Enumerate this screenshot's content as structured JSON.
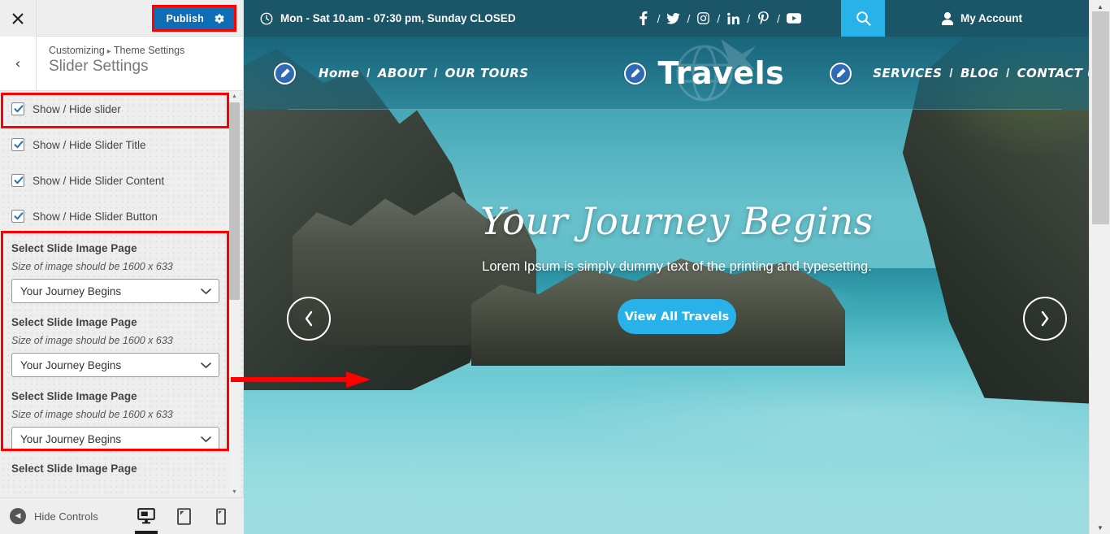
{
  "customizer": {
    "close_label": "×",
    "publish_label": "Publish",
    "gear_icon": "gear-icon",
    "back_label": "‹",
    "breadcrumb_root": "Customizing",
    "breadcrumb_sep": "▸",
    "breadcrumb_parent": "Theme Settings",
    "panel_title": "Slider Settings",
    "checkboxes": [
      {
        "label": "Show / Hide slider",
        "checked": true
      },
      {
        "label": "Show / Hide Slider Title",
        "checked": true
      },
      {
        "label": "Show / Hide Slider Content",
        "checked": true
      },
      {
        "label": "Show / Hide Slider Button",
        "checked": true
      }
    ],
    "slide_fields": [
      {
        "title": "Select Slide Image Page",
        "desc": "Size of image should be  1600 x 633",
        "value": "Your Journey Begins"
      },
      {
        "title": "Select Slide Image Page",
        "desc": "Size of image should be  1600 x 633",
        "value": "Your Journey Begins"
      },
      {
        "title": "Select Slide Image Page",
        "desc": "Size of image should be  1600 x 633",
        "value": "Your Journey Begins"
      }
    ],
    "partial_field_title": "Select Slide Image Page",
    "footer": {
      "hide_controls_label": "Hide Controls",
      "devices": [
        "desktop-icon",
        "tablet-icon",
        "mobile-icon"
      ],
      "active_device": "desktop-icon"
    },
    "highlight_color": "#ff0000",
    "publish_bg": "#0e6db5"
  },
  "site": {
    "topbar": {
      "hours": "Mon - Sat 10.am - 07:30 pm, Sunday CLOSED",
      "clock_icon": "clock-icon",
      "socials": [
        {
          "name": "facebook-icon",
          "glyph": "f"
        },
        {
          "name": "twitter-icon",
          "glyph": "t"
        },
        {
          "name": "instagram-icon",
          "glyph": "i"
        },
        {
          "name": "linkedin-icon",
          "glyph": "in"
        },
        {
          "name": "pinterest-icon",
          "glyph": "p"
        },
        {
          "name": "youtube-icon",
          "glyph": "y"
        }
      ],
      "social_separator": "/",
      "search_icon": "search-icon",
      "account_label": "My Account",
      "account_icon": "user-icon",
      "bg": "#1a5568",
      "search_bg": "#29b2ea"
    },
    "nav": {
      "left_links": [
        "Home",
        "ABOUT",
        "OUR TOURS"
      ],
      "right_links": [
        "SERVICES",
        "BLOG",
        "CONTACT US"
      ],
      "separator": "/",
      "brand": "Travels",
      "edit_icon": "pencil-edit-icon"
    },
    "hero": {
      "title": "Your Journey Begins",
      "subtitle": "Lorem Ipsum is simply dummy text of the printing and typesetting.",
      "button_label": "View All Travels",
      "button_bg": "#29b2ea",
      "prev_icon": "chevron-left-icon",
      "next_icon": "chevron-right-icon"
    }
  }
}
